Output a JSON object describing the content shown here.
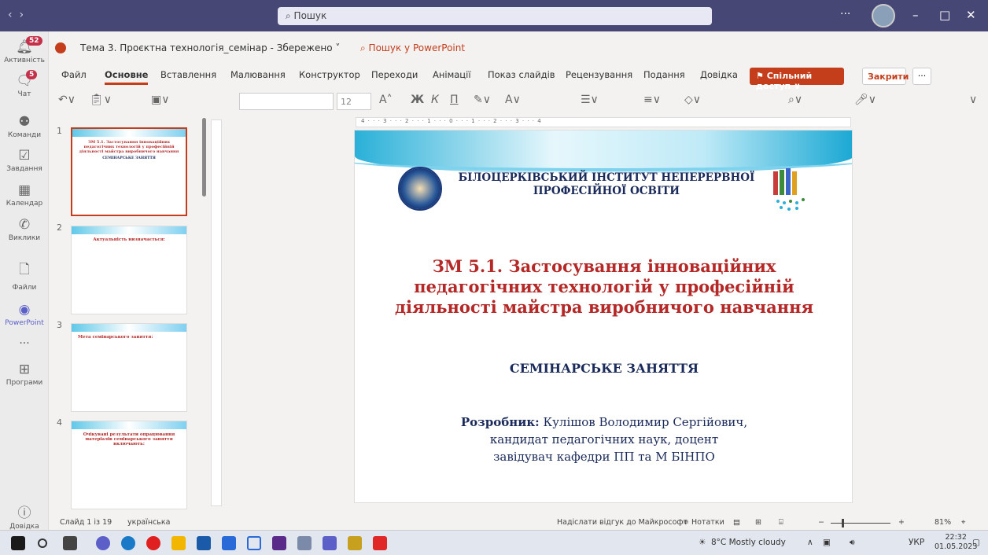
{
  "window": {
    "search_placeholder": "Пошук",
    "more": "···"
  },
  "rail": {
    "items": [
      {
        "label": "Активність",
        "badge": "52"
      },
      {
        "label": "Чат",
        "badge": "5"
      },
      {
        "label": "Команди"
      },
      {
        "label": "Завдання"
      },
      {
        "label": "Календар"
      },
      {
        "label": "Виклики"
      },
      {
        "label": "Файли"
      },
      {
        "label": "PowerPoint"
      },
      {
        "label": "..."
      },
      {
        "label": "Програми"
      },
      {
        "label": "Довідка"
      }
    ]
  },
  "doc": {
    "title": "Тема 3. Проєктна технологія_семінар - Збережено ˅",
    "search": "Пошук у PowerPoint"
  },
  "ribbon": {
    "tabs": [
      "Файл",
      "Основне",
      "Вставлення",
      "Малювання",
      "Конструктор",
      "Переходи",
      "Анімації",
      "Показ слайдів",
      "Рецензування",
      "Подання",
      "Довідка"
    ],
    "share": "Спільний доступ",
    "close": "Закрити",
    "more": "···",
    "font_size": "12"
  },
  "thumbnails": [
    {
      "num": "1",
      "heading": "ЗМ 5.1. Застосування інноваційних педагогічних технологій у професійній діяльності майстра виробничого навчання",
      "sub": "СЕМІНАРСЬКЕ ЗАНЯТТЯ"
    },
    {
      "num": "2",
      "heading": "Актуальність визначається:"
    },
    {
      "num": "3",
      "heading": "Мета семінарського заняття:"
    },
    {
      "num": "4",
      "heading": "Очікувані результати опрацювання матеріалів семінарського заняття включають:"
    }
  ],
  "ruler": {
    "h": "4 · · · 3 · · · 2 · · · 1 · · · 0 · · · 1 · · · 2 · · · 3 · · · 4",
    "v": [
      "3",
      "2",
      "1",
      "0",
      "1",
      "2",
      "3"
    ]
  },
  "slide": {
    "institute": "БІЛОЦЕРКІВСЬКИЙ ІНСТИТУТ НЕПЕРЕРВНОЇ ПРОФЕСІЙНОЇ ОСВІТИ",
    "title": "ЗМ 5.1. Застосування інноваційних педагогічних технологій у професійній діяльності майстра виробничого навчання",
    "type": "СЕМІНАРСЬКЕ ЗАНЯТТЯ",
    "dev_label": "Розробник:",
    "dev_name": " Кулішов Володимир Сергійович,",
    "dev_line2": "кандидат педагогічних наук, доцент",
    "dev_line3": "завідувач кафедри ПП та М БІНПО"
  },
  "status": {
    "slide": "Слайд 1 із 19",
    "lang": "українська",
    "feedback": "Надіслати відгук до Майкрософт",
    "notes": "≑ Нотатки",
    "zoom": "81%"
  },
  "taskbar": {
    "weather": "8°C  Mostly cloudy",
    "lang": "УКР",
    "time": "22:32",
    "date": "01.05.2023"
  }
}
